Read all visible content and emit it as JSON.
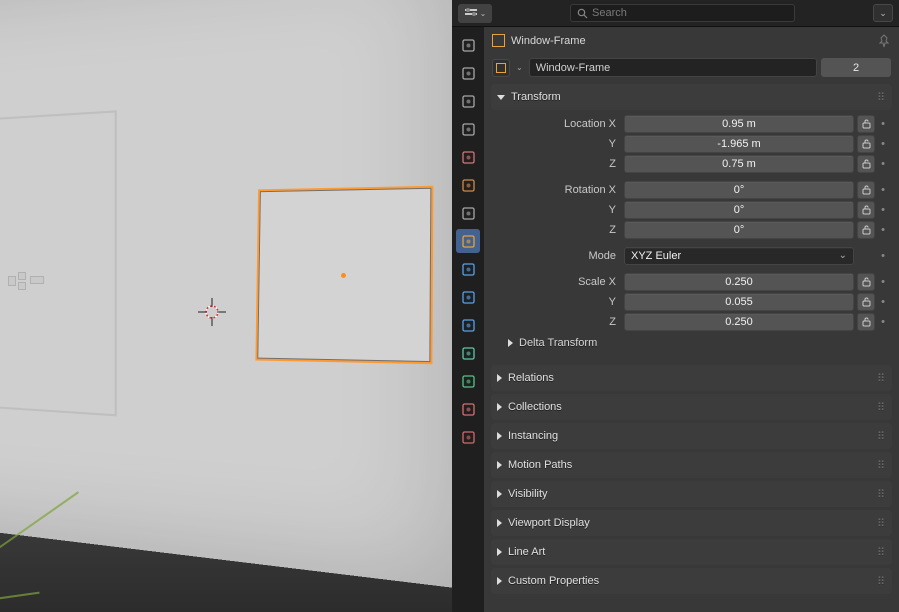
{
  "search": {
    "placeholder": "Search"
  },
  "object": {
    "name": "Window-Frame",
    "users": "2"
  },
  "panels": {
    "transform": {
      "title": "Transform",
      "rows": [
        {
          "label": "Location X",
          "value": "0.95 m",
          "lock": true
        },
        {
          "label": "Y",
          "value": "-1.965 m",
          "lock": true
        },
        {
          "label": "Z",
          "value": "0.75 m",
          "lock": true
        },
        {
          "label": "Rotation X",
          "value": "0°",
          "lock": true
        },
        {
          "label": "Y",
          "value": "0°",
          "lock": true
        },
        {
          "label": "Z",
          "value": "0°",
          "lock": true
        },
        {
          "label": "Mode",
          "value": "XYZ Euler",
          "dropdown": true
        },
        {
          "label": "Scale X",
          "value": "0.250",
          "lock": true
        },
        {
          "label": "Y",
          "value": "0.055",
          "lock": true
        },
        {
          "label": "Z",
          "value": "0.250",
          "lock": true
        }
      ],
      "sub": "Delta Transform"
    },
    "others": [
      "Relations",
      "Collections",
      "Instancing",
      "Motion Paths",
      "Visibility",
      "Viewport Display",
      "Line Art",
      "Custom Properties"
    ]
  },
  "tabs": [
    {
      "name": "tool",
      "color": "#a7a7a7",
      "active": false
    },
    {
      "name": "render",
      "color": "#a7a7a7",
      "active": false
    },
    {
      "name": "output",
      "color": "#a7a7a7",
      "active": false
    },
    {
      "name": "viewlayer",
      "color": "#a7a7a7",
      "active": false
    },
    {
      "name": "scene",
      "color": "#d07878",
      "active": false
    },
    {
      "name": "world",
      "color": "#cf8a4a",
      "active": false
    },
    {
      "name": "collection",
      "color": "#a7a7a7",
      "active": false
    },
    {
      "name": "object",
      "color": "#e8a33a",
      "active": true
    },
    {
      "name": "modifiers",
      "color": "#5aa0e6",
      "active": false
    },
    {
      "name": "particles",
      "color": "#5aa0e6",
      "active": false
    },
    {
      "name": "physics",
      "color": "#5aa0e6",
      "active": false
    },
    {
      "name": "constraints",
      "color": "#5ec7a8",
      "active": false
    },
    {
      "name": "data",
      "color": "#56c386",
      "active": false
    },
    {
      "name": "material",
      "color": "#d27070",
      "active": false
    },
    {
      "name": "texture",
      "color": "#cf6b6b",
      "active": false
    }
  ]
}
